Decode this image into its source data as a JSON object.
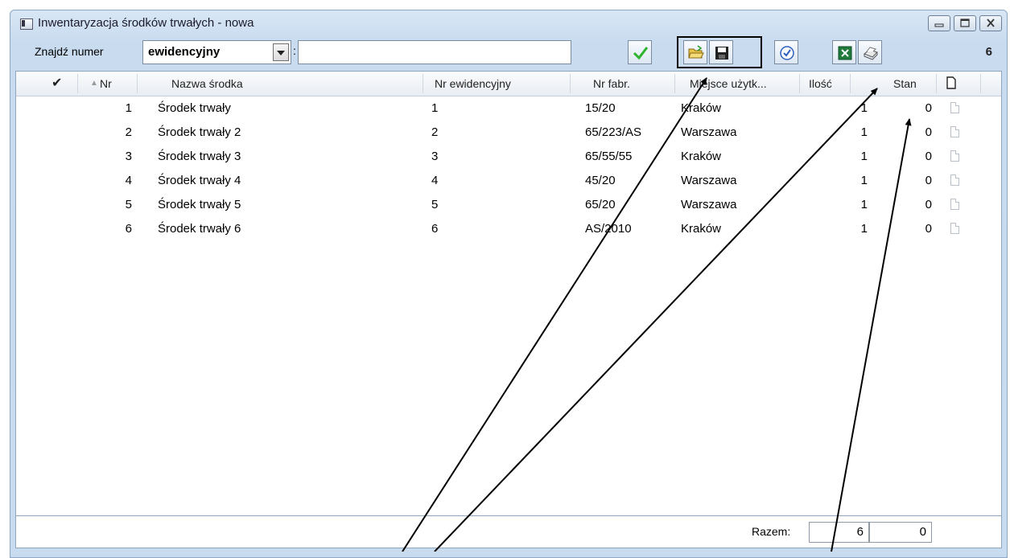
{
  "window": {
    "title": "Inwentaryzacja środków trwałych - nowa"
  },
  "toolbar": {
    "find_label": "Znajdź numer",
    "find_by_value": "ewidencyjny",
    "find_colon": ":",
    "search_value": "",
    "count": "6",
    "icons": [
      "confirm-check-icon",
      "open-folder-icon",
      "save-floppy-icon",
      "verify-check-icon",
      "excel-icon",
      "print-icon"
    ]
  },
  "table": {
    "headers": {
      "check": "✔",
      "nr": "Nr",
      "name": "Nazwa środka",
      "ev": "Nr ewidencyjny",
      "fab": "Nr fabr.",
      "place": "Miejsce użytk...",
      "qty": "Ilość",
      "state": "Stan",
      "doc": ""
    },
    "rows": [
      {
        "nr": "1",
        "name": "Środek trwały",
        "ev": "1",
        "fab": "15/20",
        "place": "Kraków",
        "qty": "1",
        "state": "0"
      },
      {
        "nr": "2",
        "name": "Środek trwały 2",
        "ev": "2",
        "fab": "65/223/AS",
        "place": "Warszawa",
        "qty": "1",
        "state": "0"
      },
      {
        "nr": "3",
        "name": "Środek trwały 3",
        "ev": "3",
        "fab": "65/55/55",
        "place": "Kraków",
        "qty": "1",
        "state": "0"
      },
      {
        "nr": "4",
        "name": "Środek trwały 4",
        "ev": "4",
        "fab": "45/20",
        "place": "Warszawa",
        "qty": "1",
        "state": "0"
      },
      {
        "nr": "5",
        "name": "Środek trwały 5",
        "ev": "5",
        "fab": "65/20",
        "place": "Warszawa",
        "qty": "1",
        "state": "0"
      },
      {
        "nr": "6",
        "name": "Środek trwały 6",
        "ev": "6",
        "fab": "AS/2010",
        "place": "Kraków",
        "qty": "1",
        "state": "0"
      }
    ]
  },
  "footer": {
    "razem_label": "Razem:",
    "qty_total": "6",
    "state_total": "0"
  }
}
